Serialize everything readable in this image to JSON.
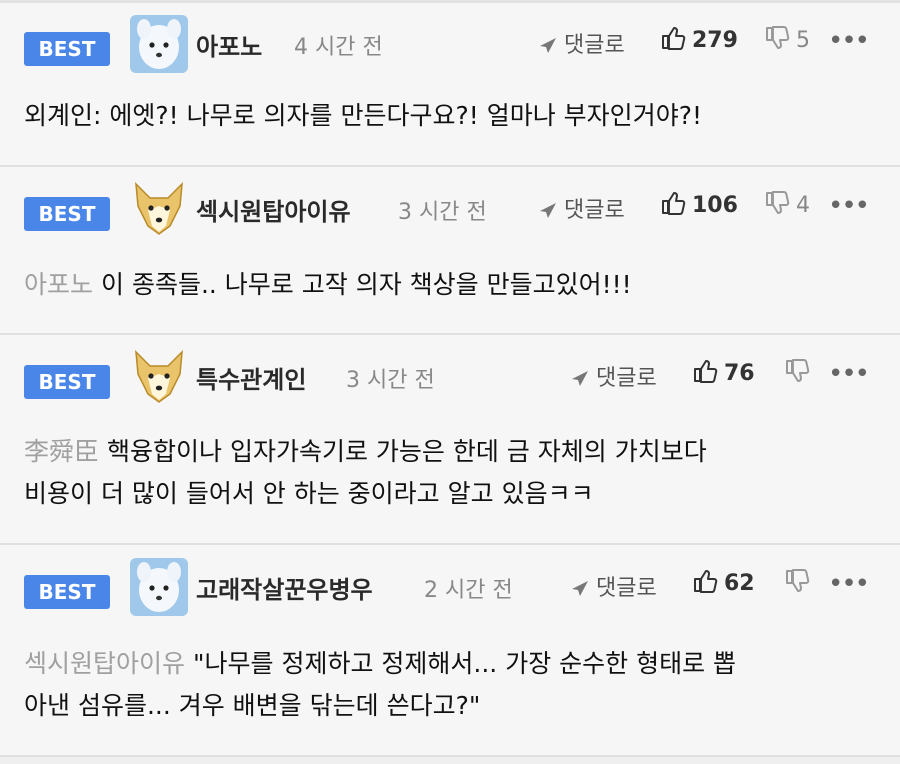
{
  "badge_label": "BEST",
  "reply_label": "댓글로",
  "comments": [
    {
      "nickname": "아포노",
      "time": "4 시간 전",
      "likes": "279",
      "dislikes": "5",
      "avatar_icon": "white-dog-avatar-icon",
      "mention": "",
      "text": "외계인: 에엣?! 나무로 의자를 만든다구요?! 얼마나 부자인거야?!"
    },
    {
      "nickname": "섹시원탑아이유",
      "time": "3 시간 전",
      "likes": "106",
      "dislikes": "4",
      "avatar_icon": "shiba-dog-avatar-icon",
      "mention": "아포노",
      "text": "이 종족들.. 나무로 고작 의자 책상을 만들고있어!!!"
    },
    {
      "nickname": "특수관계인",
      "time": "3 시간 전",
      "likes": "76",
      "dislikes": "",
      "avatar_icon": "shiba-dog-avatar-icon",
      "mention": "李舜臣",
      "text": "핵융합이나 입자가속기로 가능은 한데 금 자체의 가치보다",
      "text2": "비용이 더 많이 들어서 안 하는 중이라고 알고 있음ㅋㅋ"
    },
    {
      "nickname": "고래작살꾼우병우",
      "time": "2 시간 전",
      "likes": "62",
      "dislikes": "",
      "avatar_icon": "white-dog-avatar-icon",
      "mention": "섹시원탑아이유",
      "text": "\"나무를 정제하고 정제해서... 가장 순수한 형태로 뽑",
      "text2": "아낸 섬유를... 겨우 배변을 닦는데 쓴다고?\""
    }
  ]
}
